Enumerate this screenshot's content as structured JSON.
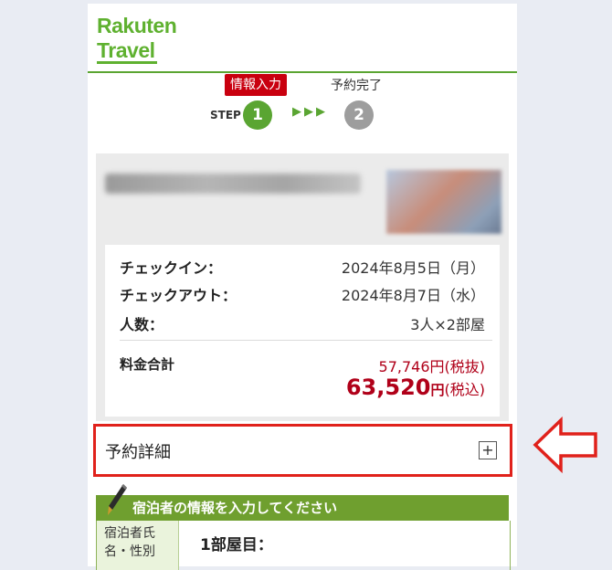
{
  "brand": {
    "line1": "Rakuten",
    "line2": "Travel",
    "color": "#5fb130"
  },
  "steps": {
    "word": "STEP",
    "active_label": "情報入力",
    "done_label": "予約完了",
    "step1": "1",
    "step2": "2",
    "arrows": "▶▶▶"
  },
  "booking": {
    "checkin_label": "チェックイン：",
    "checkin_value": "2024年8月5日（月）",
    "checkout_label": "チェックアウト：",
    "checkout_value": "2024年8月7日（水）",
    "guests_label": "人数：",
    "guests_value": "3人×2部屋",
    "total_label": "料金合計",
    "price_excl": "57,746円(税抜)",
    "price_incl_amount": "63,520",
    "price_incl_unit": "円",
    "price_incl_tax": "(税込)"
  },
  "reservation_detail": {
    "label": "予約詳細",
    "toggle": "+"
  },
  "guest_section": {
    "header": "宿泊者の情報を入力してください",
    "name_label_line1": "宿泊者氏",
    "name_label_line2": "名・性別",
    "room_label": "1部屋目："
  },
  "colors": {
    "accent_green": "#5aa532",
    "active_step": "#c9000f",
    "price_red": "#b00019",
    "highlight_red": "#e0211b"
  }
}
